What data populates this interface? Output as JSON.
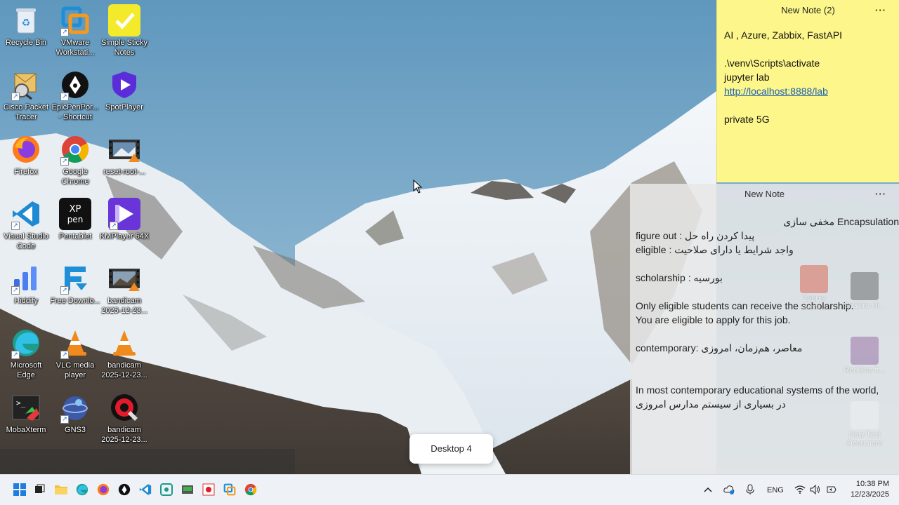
{
  "desktop_icons": [
    {
      "label": "Recycle Bin",
      "icon": "recycle-bin-icon"
    },
    {
      "label": "VMware Workstati...",
      "icon": "vmware-icon"
    },
    {
      "label": "Simple Sticky Notes",
      "icon": "sticky-notes-icon"
    },
    {
      "label": "Cisco Packet Tracer",
      "icon": "cisco-packet-tracer-icon"
    },
    {
      "label": "EpicPenPor... - Shortcut",
      "icon": "epicpen-icon"
    },
    {
      "label": "SpotPlayer",
      "icon": "spotplayer-icon"
    },
    {
      "label": "Firefox",
      "icon": "firefox-icon"
    },
    {
      "label": "Google Chrome",
      "icon": "chrome-icon"
    },
    {
      "label": "reset-root-...",
      "icon": "video-file-icon"
    },
    {
      "label": "Visual Studio Code",
      "icon": "vscode-icon"
    },
    {
      "label": "Pentablet",
      "icon": "xppen-icon"
    },
    {
      "label": "KMPlayer 64X",
      "icon": "kmplayer-icon"
    },
    {
      "label": "Hiddify",
      "icon": "hiddify-icon"
    },
    {
      "label": "Free Downlo...",
      "icon": "free-download-manager-icon"
    },
    {
      "label": "bandicam 2025-12-23...",
      "icon": "video-file-icon"
    },
    {
      "label": "Microsoft Edge",
      "icon": "edge-icon"
    },
    {
      "label": "VLC media player",
      "icon": "vlc-icon"
    },
    {
      "label": "bandicam 2025-12-23...",
      "icon": "vlc-file-icon"
    },
    {
      "label": "MobaXterm",
      "icon": "mobaxterm-icon"
    },
    {
      "label": "GNS3",
      "icon": "gns3-icon"
    },
    {
      "label": "bandicam 2025-12-23...",
      "icon": "bandicam-icon"
    }
  ],
  "note_yellow": {
    "title": "New Note (2)",
    "menu": "···",
    "line1": "AI , Azure, Zabbix, FastAPI",
    "line2": ".\\venv\\Scripts\\activate",
    "line3": "jupyter lab",
    "link": "http://localhost:8888/lab",
    "line4": "private 5G"
  },
  "note_gray": {
    "title": "New Note",
    "menu": "···",
    "line1": "Encapsulation مخفی سازی",
    "line2": "figure out :  پیدا کردن راه حل",
    "line3": "eligible : واجد شرایط یا دارای صلاحیت",
    "line4": "scholarship : بورسیه",
    "line5": "Only eligible students can receive the scholarship.",
    "line6": "You are eligible to apply for this job.",
    "line7": "contemporary: معاصر، هم‌زمان، امروزی",
    "line8": "In most contemporary educational systems of the world,",
    "line9": "در بسیاری از سیستم مدارس امروزی"
  },
  "ghost_icons": [
    {
      "label": "Zabbix overv..."
    },
    {
      "label": "Shakira Hi..."
    },
    {
      "label": "RedOne ft..."
    },
    {
      "label": "New Text Document"
    }
  ],
  "desktop_indicator": "Desktop 4",
  "taskbar": {
    "lang": "ENG",
    "time": "10:38 PM",
    "date": "12/23/2025"
  }
}
